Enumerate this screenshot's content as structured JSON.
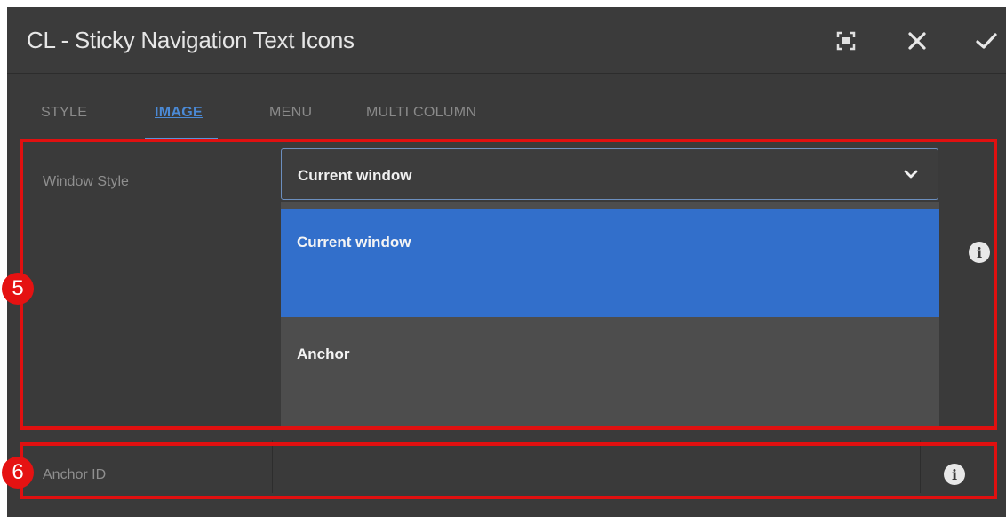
{
  "dialog": {
    "title": "CL - Sticky Navigation Text Icons",
    "icons": [
      "fullscreen-icon",
      "close-icon",
      "check-icon"
    ]
  },
  "tabs": [
    {
      "label": "STYLE",
      "active": false
    },
    {
      "label": "IMAGE",
      "active": true
    },
    {
      "label": "MENU",
      "active": false
    },
    {
      "label": "MULTI COLUMN",
      "active": false
    }
  ],
  "window_style": {
    "label": "Window Style",
    "selected": "Current window",
    "options": [
      "Current window",
      "Anchor"
    ]
  },
  "anchor_id": {
    "label": "Anchor ID",
    "value": ""
  },
  "annotations": {
    "badge_5": "5",
    "badge_6": "6"
  },
  "colors": {
    "accent": "#326fcb",
    "annotation_red": "#e01010",
    "panel_bg": "#3a3a3a"
  }
}
